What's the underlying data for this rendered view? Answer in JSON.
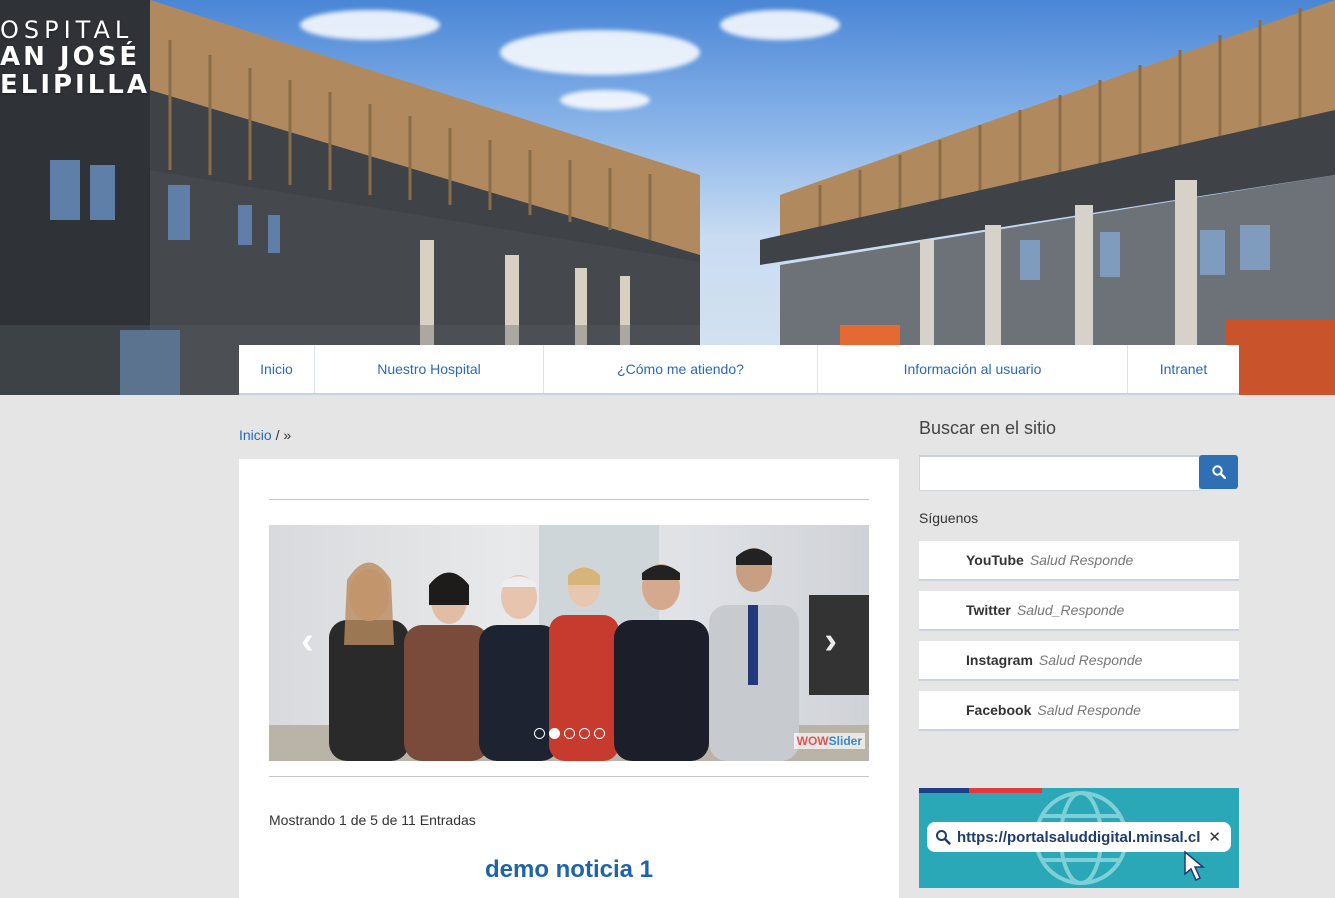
{
  "logo": {
    "line1": "OSPITAL",
    "line2": "AN JOSÉ",
    "line3": "ELIPILLA"
  },
  "nav": {
    "items": [
      {
        "label": "Inicio"
      },
      {
        "label": "Nuestro Hospital"
      },
      {
        "label": "¿Cómo me atiendo?"
      },
      {
        "label": "Información al usuario"
      },
      {
        "label": "Intranet"
      }
    ]
  },
  "breadcrumb": {
    "home": "Inicio",
    "separator": "/",
    "current": "»"
  },
  "slider": {
    "prev_icon": "chevron-left-icon",
    "next_icon": "chevron-right-icon",
    "dots_total": 5,
    "active_dot": 2,
    "brand_wow": "WOW",
    "brand_slider": "Slider"
  },
  "listing": {
    "count_text": "Mostrando 1 de 5 de 11 Entradas",
    "first_title": "demo noticia 1"
  },
  "sidebar": {
    "search_title": "Buscar en el sitio",
    "search_value": "",
    "search_icon": "search-icon",
    "follow_title": "Síguenos",
    "social": [
      {
        "network": "YouTube",
        "handle": "Salud Responde"
      },
      {
        "network": "Twitter",
        "handle": "Salud_Responde"
      },
      {
        "network": "Instagram",
        "handle": "Salud Responde"
      },
      {
        "network": "Facebook",
        "handle": "Salud Responde"
      }
    ],
    "banner": {
      "url": "https://portalsaluddigital.minsal.cl",
      "close": "✕"
    }
  },
  "colors": {
    "link": "#2a6ab3",
    "button": "#2f6fb4",
    "background": "#e5e5e5",
    "banner": "#2aa8b8"
  }
}
